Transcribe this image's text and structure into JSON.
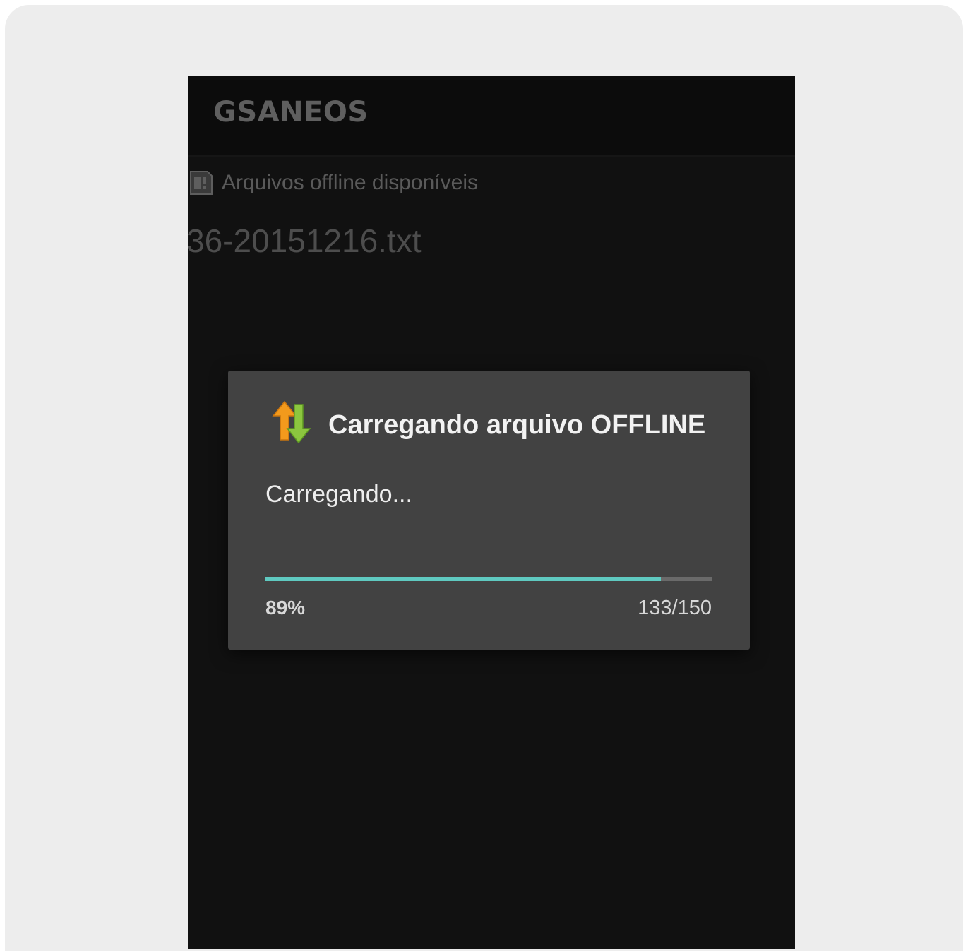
{
  "app": {
    "title": "GSANEOS"
  },
  "header": {
    "icon": "sd-card-icon",
    "label": "Arquivos offline disponíveis"
  },
  "file_list": {
    "items": [
      {
        "name": "36-20151216.txt"
      }
    ]
  },
  "dialog": {
    "icon": "transfer-arrows-icon",
    "title": "Carregando arquivo OFFLINE",
    "message": "Carregando...",
    "progress": {
      "percent_label": "89%",
      "count_label": "133/150",
      "current": 133,
      "total": 150
    }
  },
  "colors": {
    "progress_fill": "#5fc9c0",
    "progress_track": "#6a6a6a",
    "dialog_bg": "#424242",
    "screen_bg": "#111111",
    "icon_up_arrow": "#f39a1c",
    "icon_down_arrow": "#8cc63f"
  }
}
